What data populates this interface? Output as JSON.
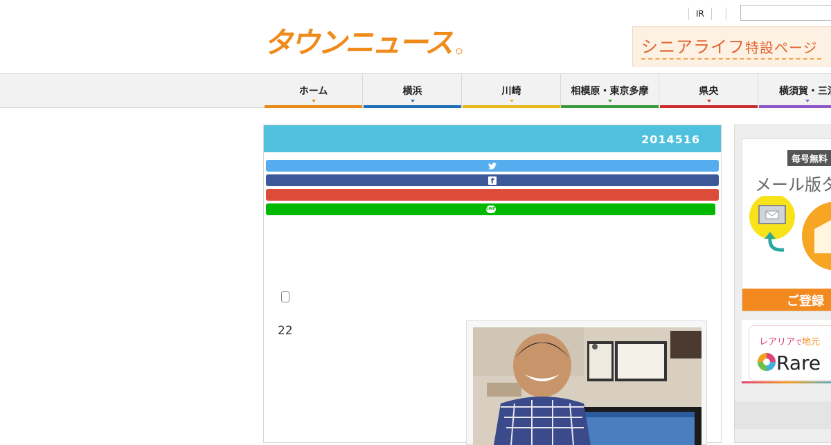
{
  "header": {
    "logo_text": "タウンニュース",
    "util_ir": "IR",
    "search_placeholder": "",
    "senior_banner": {
      "main": "シニアライフ",
      "sub": "特設ページ"
    }
  },
  "nav": {
    "items": [
      {
        "label": "ホーム",
        "color": "#e88a17"
      },
      {
        "label": "横浜",
        "color": "#1f6fb8"
      },
      {
        "label": "川崎",
        "color": "#e8b81b"
      },
      {
        "label": "相模原・東京多摩",
        "color": "#3a9a3a"
      },
      {
        "label": "県央",
        "color": "#c92d2d"
      },
      {
        "label": "横須賀・三浦",
        "color": "#8e57c8"
      }
    ]
  },
  "article": {
    "date": "2014516",
    "share": [
      {
        "name": "twitter",
        "color": "#55acee"
      },
      {
        "name": "facebook",
        "color": "#3b5998"
      },
      {
        "name": "google-plus",
        "color": "#dd4b39"
      },
      {
        "name": "line",
        "color": "#00b900",
        "icon_text": "LINE"
      }
    ],
    "number": "22"
  },
  "sidebar": {
    "mail_ad": {
      "badge": "毎号無料",
      "headline": "メール版タ",
      "cta": "ご登録"
    },
    "rarea_ad": {
      "line1_a": "レアリア",
      "line1_b": "で",
      "line1_c": "地元",
      "brand": "Rare"
    }
  }
}
